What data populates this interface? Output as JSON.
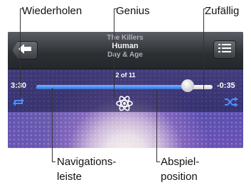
{
  "callouts": {
    "wiederholen": "Wiederholen",
    "genius": "Genius",
    "zufaellig": "Zufällig",
    "navigation_line1": "Navigations-",
    "navigation_line2": "leiste",
    "abspiel_line1": "Abspiel-",
    "abspiel_line2": "position"
  },
  "track": {
    "artist": "The Killers",
    "song": "Human",
    "album": "Day & Age",
    "counter": "2 of 11"
  },
  "playback": {
    "elapsed": "3:30",
    "remaining": "-0:35",
    "progress_fraction": 0.86
  },
  "icons": {
    "back": "back-arrow-icon",
    "list": "track-list-icon",
    "repeat": "repeat-icon",
    "shuffle": "shuffle-icon",
    "genius": "genius-atom-icon"
  },
  "colors": {
    "accent": "#2d6fe0",
    "control_icon": "#4a90ff"
  }
}
